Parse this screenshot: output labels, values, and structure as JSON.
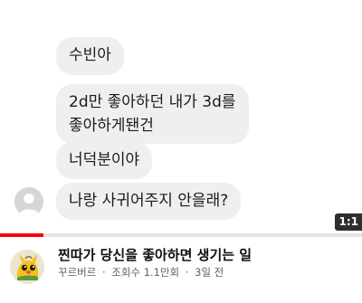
{
  "video": {
    "duration_label": "1:1",
    "progress_fraction": 0.12,
    "messages": [
      {
        "text": "수빈아"
      },
      {
        "text": "2d만 좋아하던 내가 3d를\n좋아하게됀건"
      },
      {
        "text": "너덕분이야"
      },
      {
        "text": "나랑 사귀어주지 안을래?"
      }
    ]
  },
  "meta": {
    "title": "찐따가 당신을 좋아하면 생기는 일",
    "channel": "꾸르버르",
    "views": "조회수 1.1만회",
    "age": "3일 전",
    "separator": "·"
  },
  "colors": {
    "bubble": "#efefef",
    "progress": "#ff0000",
    "title": "#0f0f0f",
    "subtext": "#606060"
  },
  "icons": {
    "chat_avatar": "default-profile-icon",
    "channel_avatar": "channel-avatar-icon"
  }
}
